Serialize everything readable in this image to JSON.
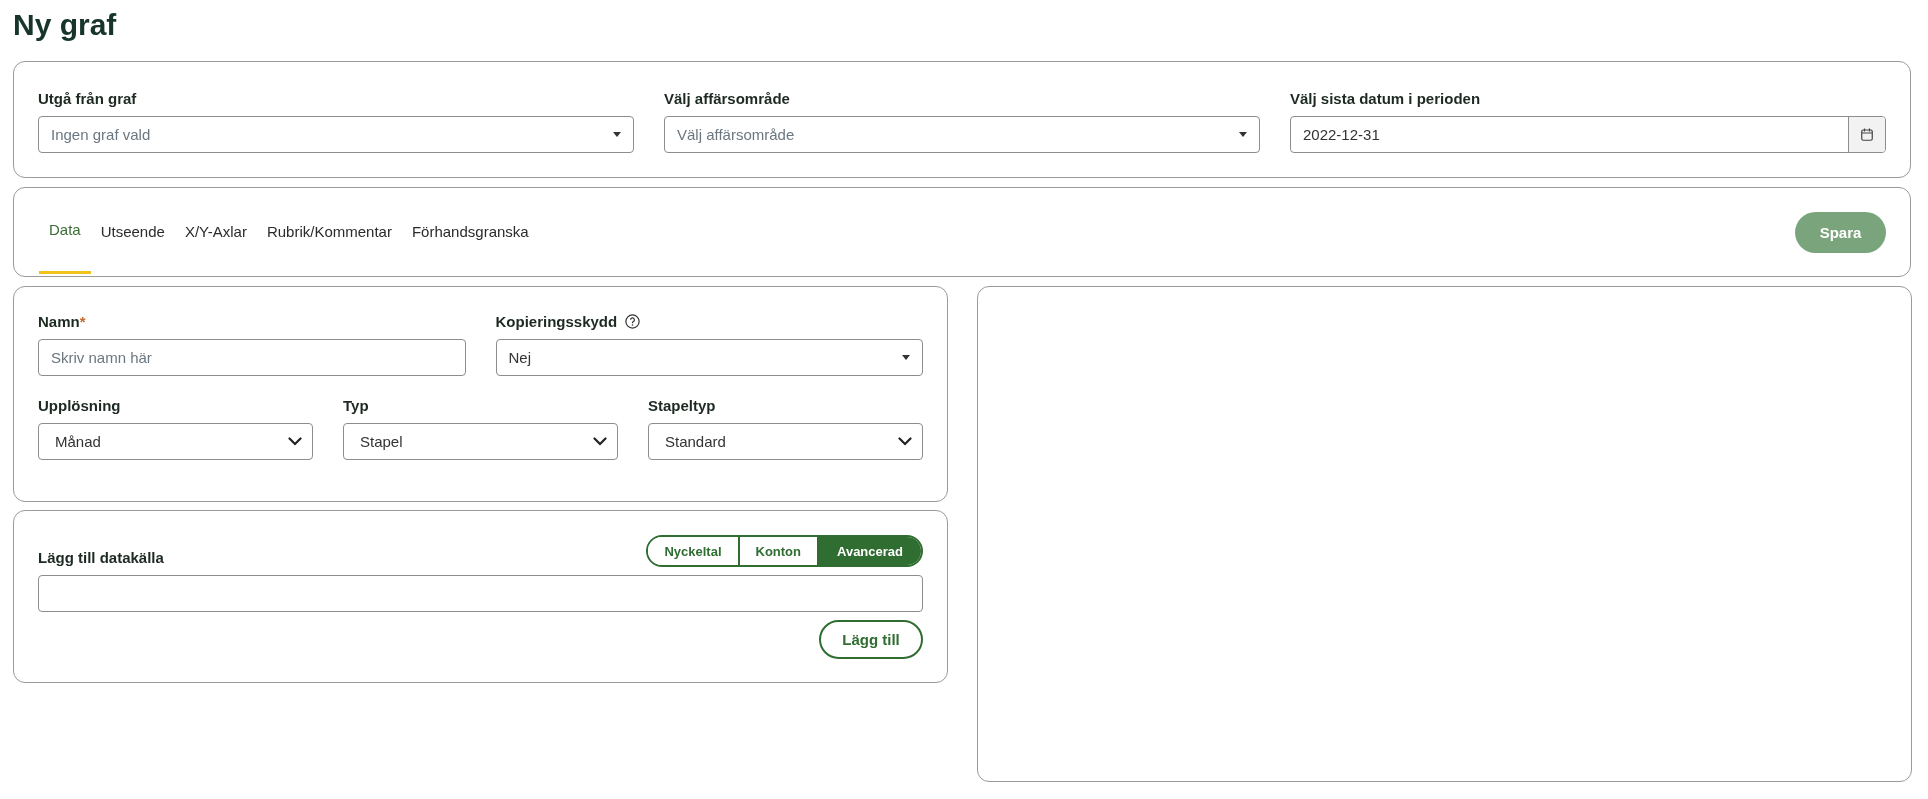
{
  "title": "Ny graf",
  "filters": [
    {
      "kind": "select",
      "label": "Utgå från graf",
      "placeholder": "Ingen graf vald"
    },
    {
      "kind": "select",
      "label": "Välj affärsområde",
      "placeholder": "Välj affärsområde"
    },
    {
      "kind": "date",
      "label": "Välj sista datum i perioden",
      "value": "2022-12-31"
    }
  ],
  "tabs": [
    {
      "label": "Data",
      "selected": true
    },
    {
      "label": "Utseende",
      "selected": false
    },
    {
      "label": "X/Y-Axlar",
      "selected": false
    },
    {
      "label": "Rubrik/Kommentar",
      "selected": false
    },
    {
      "label": "Förhandsgranska",
      "selected": false
    }
  ],
  "save_button": {
    "label": "Spara",
    "disabled": true
  },
  "settings": {
    "name": {
      "label": "Namn",
      "required_mark": "*",
      "placeholder": "Skriv namn här"
    },
    "copy_protection": {
      "label": "Kopieringsskydd",
      "value": "Nej"
    },
    "selects": [
      {
        "label": "Upplösning",
        "value": "Månad"
      },
      {
        "label": "Typ",
        "value": "Stapel"
      },
      {
        "label": "Stapeltyp",
        "value": "Standard"
      }
    ]
  },
  "data_source": {
    "label": "Lägg till datakälla",
    "modes": [
      {
        "label": "Nyckeltal",
        "selected": false
      },
      {
        "label": "Konton",
        "selected": false
      },
      {
        "label": "Avancerad",
        "selected": true
      }
    ],
    "add_button": "Lägg till"
  }
}
